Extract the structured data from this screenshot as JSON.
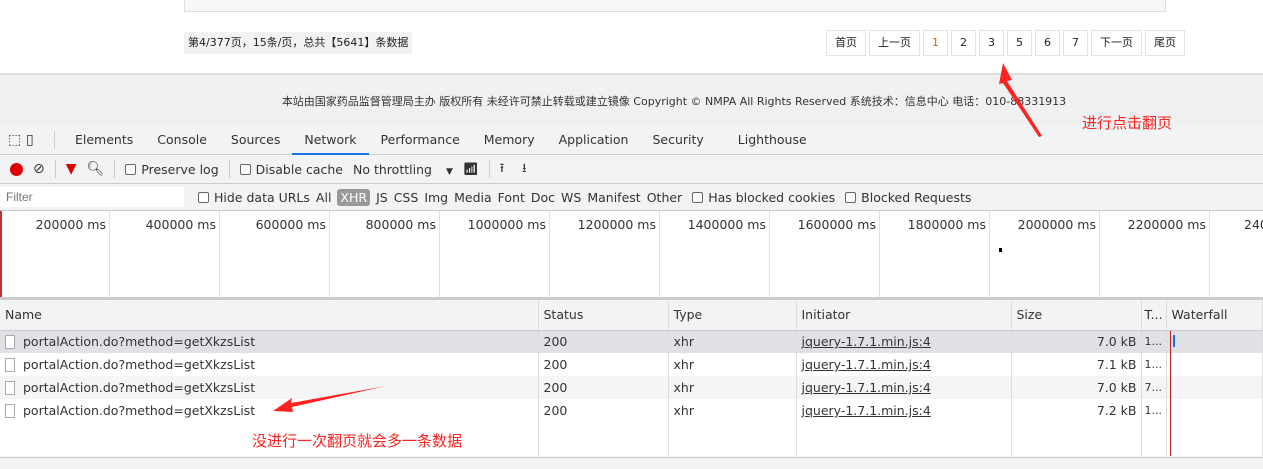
{
  "page": {
    "page_info": "第4/377页，15条/页，总共【5641】条数据",
    "pager": [
      "首页",
      "上一页",
      "1",
      "2",
      "3",
      "5",
      "6",
      "7",
      "下一页",
      "尾页"
    ],
    "footer": "本站由国家药品监督管理局主办 版权所有 未经许可禁止转载或建立镜像 Copyright © NMPA All Rights Reserved 系统技术：信息中心 电话：010-88331913"
  },
  "devtools": {
    "tabs": [
      "Elements",
      "Console",
      "Sources",
      "Network",
      "Performance",
      "Memory",
      "Application",
      "Security",
      "Lighthouse"
    ],
    "active_tab": "Network",
    "toolbar": {
      "preserve_log": "Preserve log",
      "disable_cache": "Disable cache",
      "throttling": "No throttling"
    },
    "filter": {
      "placeholder": "Filter",
      "hide_data_urls": "Hide data URLs",
      "types": [
        "All",
        "XHR",
        "JS",
        "CSS",
        "Img",
        "Media",
        "Font",
        "Doc",
        "WS",
        "Manifest",
        "Other"
      ],
      "active_type": "XHR",
      "has_blocked_cookies": "Has blocked cookies",
      "blocked_requests": "Blocked Requests"
    },
    "timeline_ticks": [
      "200000 ms",
      "400000 ms",
      "600000 ms",
      "800000 ms",
      "1000000 ms",
      "1200000 ms",
      "1400000 ms",
      "1600000 ms",
      "1800000 ms",
      "2000000 ms",
      "2200000 ms",
      "240"
    ],
    "columns": [
      "Name",
      "Status",
      "Type",
      "Initiator",
      "Size",
      "T...",
      "Waterfall"
    ],
    "rows": [
      {
        "name": "portalAction.do?method=getXkzsList",
        "status": "200",
        "type": "xhr",
        "initiator": "jquery-1.7.1.min.js:4",
        "size": "7.0 kB",
        "time": "1..."
      },
      {
        "name": "portalAction.do?method=getXkzsList",
        "status": "200",
        "type": "xhr",
        "initiator": "jquery-1.7.1.min.js:4",
        "size": "7.1 kB",
        "time": "1..."
      },
      {
        "name": "portalAction.do?method=getXkzsList",
        "status": "200",
        "type": "xhr",
        "initiator": "jquery-1.7.1.min.js:4",
        "size": "7.0 kB",
        "time": "7..."
      },
      {
        "name": "portalAction.do?method=getXkzsList",
        "status": "200",
        "type": "xhr",
        "initiator": "jquery-1.7.1.min.js:4",
        "size": "7.2 kB",
        "time": "1..."
      }
    ]
  },
  "annotations": {
    "click_page": "进行点击翻页",
    "extra_row": "没进行一次翻页就会多一条数据"
  },
  "colors": {
    "accent": "#1a73e8",
    "annotation": "#ff2222",
    "record": "#d00"
  }
}
